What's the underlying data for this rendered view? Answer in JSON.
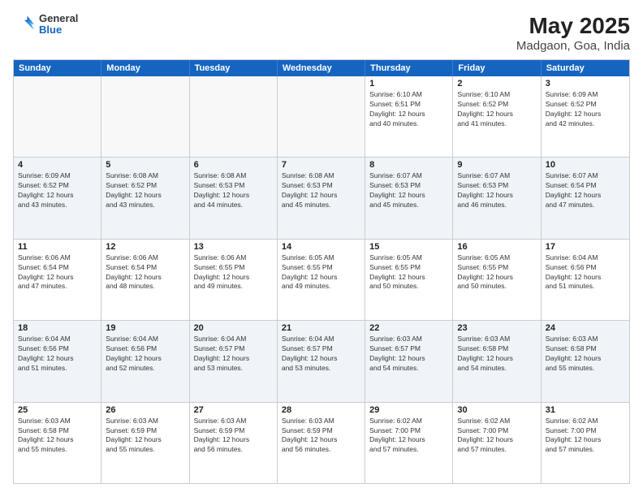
{
  "logo": {
    "line1": "General",
    "line2": "Blue"
  },
  "title": "May 2025",
  "subtitle": "Madgaon, Goa, India",
  "days_of_week": [
    "Sunday",
    "Monday",
    "Tuesday",
    "Wednesday",
    "Thursday",
    "Friday",
    "Saturday"
  ],
  "weeks": [
    [
      {
        "day": "",
        "info": ""
      },
      {
        "day": "",
        "info": ""
      },
      {
        "day": "",
        "info": ""
      },
      {
        "day": "",
        "info": ""
      },
      {
        "day": "1",
        "info": "Sunrise: 6:10 AM\nSunset: 6:51 PM\nDaylight: 12 hours\nand 40 minutes."
      },
      {
        "day": "2",
        "info": "Sunrise: 6:10 AM\nSunset: 6:52 PM\nDaylight: 12 hours\nand 41 minutes."
      },
      {
        "day": "3",
        "info": "Sunrise: 6:09 AM\nSunset: 6:52 PM\nDaylight: 12 hours\nand 42 minutes."
      }
    ],
    [
      {
        "day": "4",
        "info": "Sunrise: 6:09 AM\nSunset: 6:52 PM\nDaylight: 12 hours\nand 43 minutes."
      },
      {
        "day": "5",
        "info": "Sunrise: 6:08 AM\nSunset: 6:52 PM\nDaylight: 12 hours\nand 43 minutes."
      },
      {
        "day": "6",
        "info": "Sunrise: 6:08 AM\nSunset: 6:53 PM\nDaylight: 12 hours\nand 44 minutes."
      },
      {
        "day": "7",
        "info": "Sunrise: 6:08 AM\nSunset: 6:53 PM\nDaylight: 12 hours\nand 45 minutes."
      },
      {
        "day": "8",
        "info": "Sunrise: 6:07 AM\nSunset: 6:53 PM\nDaylight: 12 hours\nand 45 minutes."
      },
      {
        "day": "9",
        "info": "Sunrise: 6:07 AM\nSunset: 6:53 PM\nDaylight: 12 hours\nand 46 minutes."
      },
      {
        "day": "10",
        "info": "Sunrise: 6:07 AM\nSunset: 6:54 PM\nDaylight: 12 hours\nand 47 minutes."
      }
    ],
    [
      {
        "day": "11",
        "info": "Sunrise: 6:06 AM\nSunset: 6:54 PM\nDaylight: 12 hours\nand 47 minutes."
      },
      {
        "day": "12",
        "info": "Sunrise: 6:06 AM\nSunset: 6:54 PM\nDaylight: 12 hours\nand 48 minutes."
      },
      {
        "day": "13",
        "info": "Sunrise: 6:06 AM\nSunset: 6:55 PM\nDaylight: 12 hours\nand 49 minutes."
      },
      {
        "day": "14",
        "info": "Sunrise: 6:05 AM\nSunset: 6:55 PM\nDaylight: 12 hours\nand 49 minutes."
      },
      {
        "day": "15",
        "info": "Sunrise: 6:05 AM\nSunset: 6:55 PM\nDaylight: 12 hours\nand 50 minutes."
      },
      {
        "day": "16",
        "info": "Sunrise: 6:05 AM\nSunset: 6:55 PM\nDaylight: 12 hours\nand 50 minutes."
      },
      {
        "day": "17",
        "info": "Sunrise: 6:04 AM\nSunset: 6:56 PM\nDaylight: 12 hours\nand 51 minutes."
      }
    ],
    [
      {
        "day": "18",
        "info": "Sunrise: 6:04 AM\nSunset: 6:56 PM\nDaylight: 12 hours\nand 51 minutes."
      },
      {
        "day": "19",
        "info": "Sunrise: 6:04 AM\nSunset: 6:56 PM\nDaylight: 12 hours\nand 52 minutes."
      },
      {
        "day": "20",
        "info": "Sunrise: 6:04 AM\nSunset: 6:57 PM\nDaylight: 12 hours\nand 53 minutes."
      },
      {
        "day": "21",
        "info": "Sunrise: 6:04 AM\nSunset: 6:57 PM\nDaylight: 12 hours\nand 53 minutes."
      },
      {
        "day": "22",
        "info": "Sunrise: 6:03 AM\nSunset: 6:57 PM\nDaylight: 12 hours\nand 54 minutes."
      },
      {
        "day": "23",
        "info": "Sunrise: 6:03 AM\nSunset: 6:58 PM\nDaylight: 12 hours\nand 54 minutes."
      },
      {
        "day": "24",
        "info": "Sunrise: 6:03 AM\nSunset: 6:58 PM\nDaylight: 12 hours\nand 55 minutes."
      }
    ],
    [
      {
        "day": "25",
        "info": "Sunrise: 6:03 AM\nSunset: 6:58 PM\nDaylight: 12 hours\nand 55 minutes."
      },
      {
        "day": "26",
        "info": "Sunrise: 6:03 AM\nSunset: 6:59 PM\nDaylight: 12 hours\nand 55 minutes."
      },
      {
        "day": "27",
        "info": "Sunrise: 6:03 AM\nSunset: 6:59 PM\nDaylight: 12 hours\nand 56 minutes."
      },
      {
        "day": "28",
        "info": "Sunrise: 6:03 AM\nSunset: 6:59 PM\nDaylight: 12 hours\nand 56 minutes."
      },
      {
        "day": "29",
        "info": "Sunrise: 6:02 AM\nSunset: 7:00 PM\nDaylight: 12 hours\nand 57 minutes."
      },
      {
        "day": "30",
        "info": "Sunrise: 6:02 AM\nSunset: 7:00 PM\nDaylight: 12 hours\nand 57 minutes."
      },
      {
        "day": "31",
        "info": "Sunrise: 6:02 AM\nSunset: 7:00 PM\nDaylight: 12 hours\nand 57 minutes."
      }
    ]
  ]
}
